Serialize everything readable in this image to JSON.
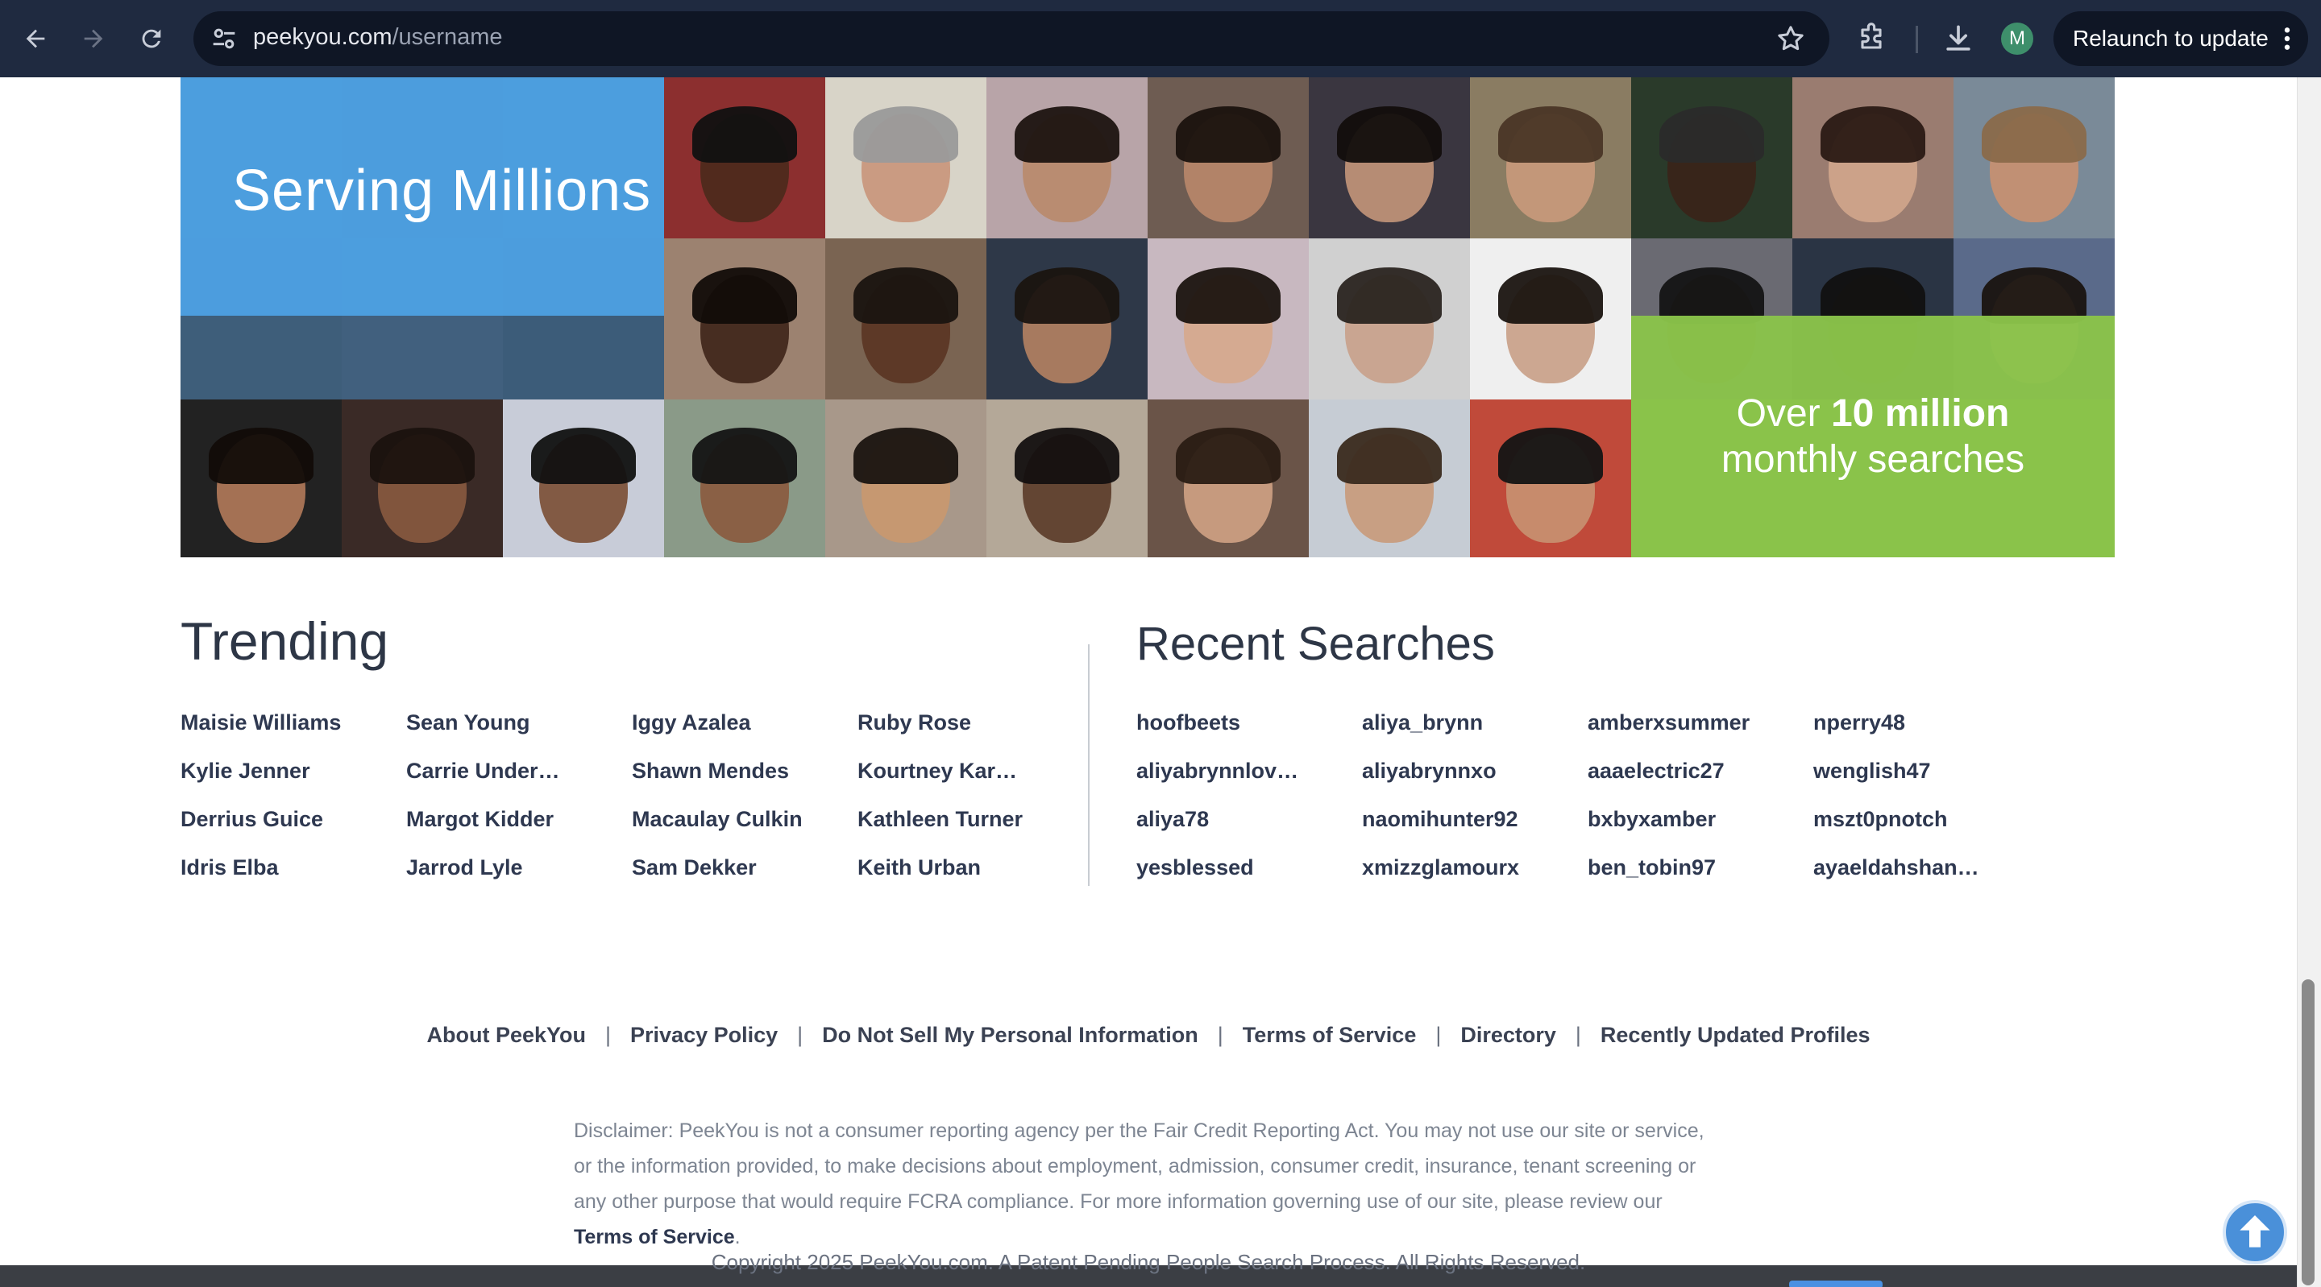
{
  "browser": {
    "url_domain": "peekyou.com",
    "url_path": "/username",
    "profile_initial": "M",
    "relaunch_label": "Relaunch to update"
  },
  "hero": {
    "title": "Serving Millions",
    "stat_prefix": "Over ",
    "stat_bold": "10 million",
    "stat_suffix": "monthly searches",
    "colors": {
      "blue_panel": "#4da3e5",
      "green_panel": "#8ac34a"
    }
  },
  "trending": {
    "title": "Trending",
    "names": [
      "Maisie Williams",
      "Sean Young",
      "Iggy Azalea",
      "Ruby Rose",
      "Kylie Jenner",
      "Carrie Under…",
      "Shawn Mendes",
      "Kourtney Kar…",
      "Derrius Guice",
      "Margot Kidder",
      "Macaulay Culkin",
      "Kathleen Turner",
      "Idris Elba",
      "Jarrod Lyle",
      "Sam Dekker",
      "Keith Urban"
    ]
  },
  "recent": {
    "title": "Recent Searches",
    "names": [
      "hoofbeets",
      "aliya_brynn",
      "amberxsummer",
      "nperry48",
      "aliyabrynnlov…",
      "aliyabrynnxo",
      "aaaelectric27",
      "wenglish47",
      "aliya78",
      "naomihunter92",
      "bxbyxamber",
      "mszt0pnotch",
      "yesblessed",
      "xmizzglamourx",
      "ben_tobin97",
      "ayaeldahshan…"
    ]
  },
  "footer": {
    "links": [
      "About PeekYou",
      "Privacy Policy",
      "Do Not Sell My Personal Information",
      "Terms of Service",
      "Directory",
      "Recently Updated Profiles"
    ],
    "disclaimer_text": "Disclaimer: PeekYou is not a consumer reporting agency per the Fair Credit Reporting Act. You may not use our site or service, or the information provided, to make decisions about employment, admission, consumer credit, insurance, tenant screening or any other purpose that would require FCRA compliance. For more information governing use of our site, please review our ",
    "disclaimer_link": "Terms of Service",
    "disclaimer_end": ".",
    "copyright": "Copyright 2025 PeekYou.com. A Patent Pending People Search Process. All Rights Reserved."
  },
  "icons": {
    "back": "arrow-left-icon",
    "forward": "arrow-right-icon",
    "reload": "reload-icon",
    "site_info": "tune-icon",
    "bookmark": "star-icon",
    "extensions": "puzzle-icon",
    "download": "download-icon",
    "menu": "more-vert-icon",
    "scroll_top": "arrow-up-circle-icon"
  }
}
